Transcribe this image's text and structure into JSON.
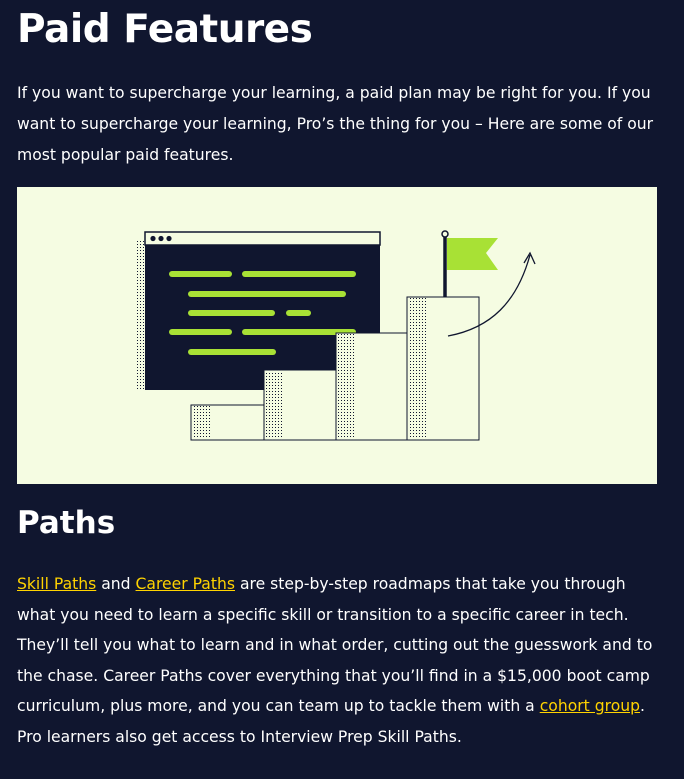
{
  "page": {
    "title": "Paid Features",
    "intro": "If you want to supercharge your learning, a paid plan may be right for you. If you want to supercharge your learning, Pro’s the thing for you – Here are some of our most popular paid features."
  },
  "illustration": {
    "icon": "code-editor-stairs-flag-illustration",
    "background_color": "#f5fce2",
    "accent_color": "#a8e135",
    "ink_color": "#10162f"
  },
  "paths": {
    "heading": "Paths",
    "link_skill_paths": "Skill Paths",
    "text_and": " and ",
    "link_career_paths": "Career Paths",
    "text_1": " are step-by-step roadmaps that take you through what you need to learn a specific skill or transition to a specific career in tech. They’ll tell you what to learn and in what order, cutting out the guesswork and to the chase. Career Paths cover everything that you’ll find in a $15,000 boot camp curriculum, plus more, and you can team up to tackle them with a ",
    "link_cohort_group": "cohort group",
    "text_2": ". Pro learners also get access to Interview Prep Skill Paths.",
    "link_color": "#ffd300"
  }
}
